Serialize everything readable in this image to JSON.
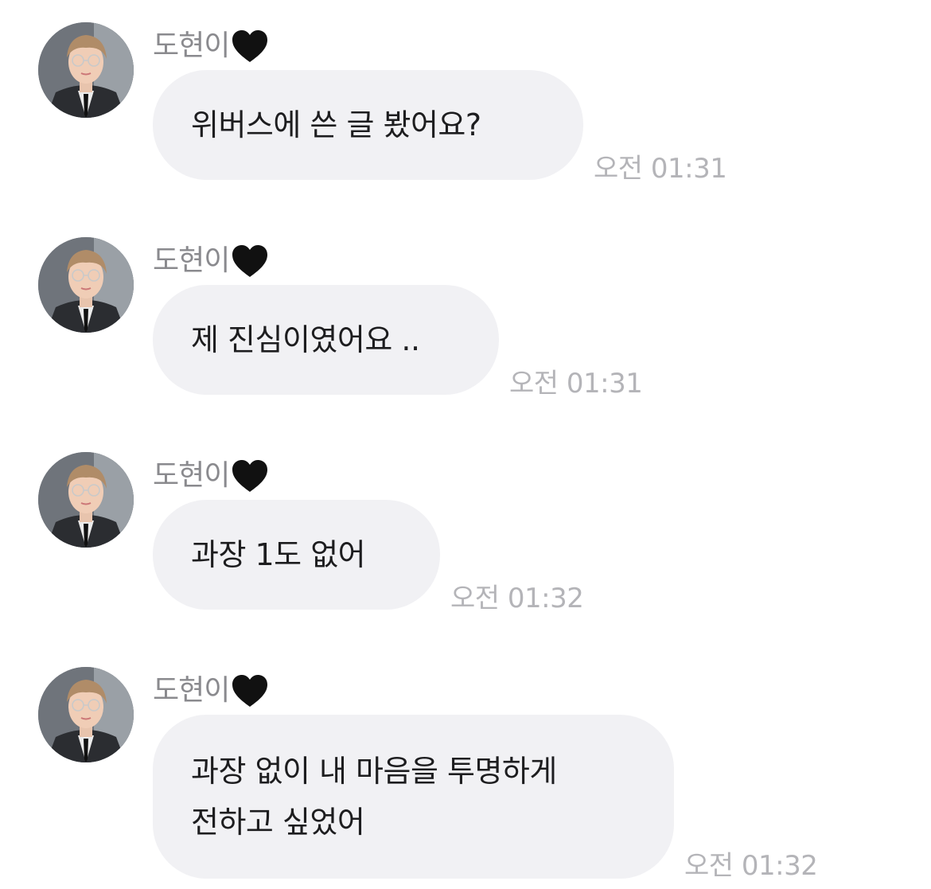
{
  "messages": [
    {
      "sender": "도현이",
      "text": "위버스에 쓴 글 봤어요?",
      "time": "오전 01:31"
    },
    {
      "sender": "도현이",
      "text": "제 진심이였어요 ..",
      "time": "오전 01:31"
    },
    {
      "sender": "도현이",
      "text": "과장 1도 없어",
      "time": "오전 01:32"
    },
    {
      "sender": "도현이",
      "text": "과장 없이 내 마음을 투명하게\n전하고 싶었어",
      "time": "오전 01:32"
    }
  ],
  "icons": {
    "heart": "black-heart-icon",
    "avatar": "profile-photo"
  },
  "colors": {
    "bubble": "#f1f1f4",
    "sender": "#8a8a8e",
    "time": "#b4b4b8",
    "text": "#1d1d1f",
    "heart": "#111111"
  }
}
